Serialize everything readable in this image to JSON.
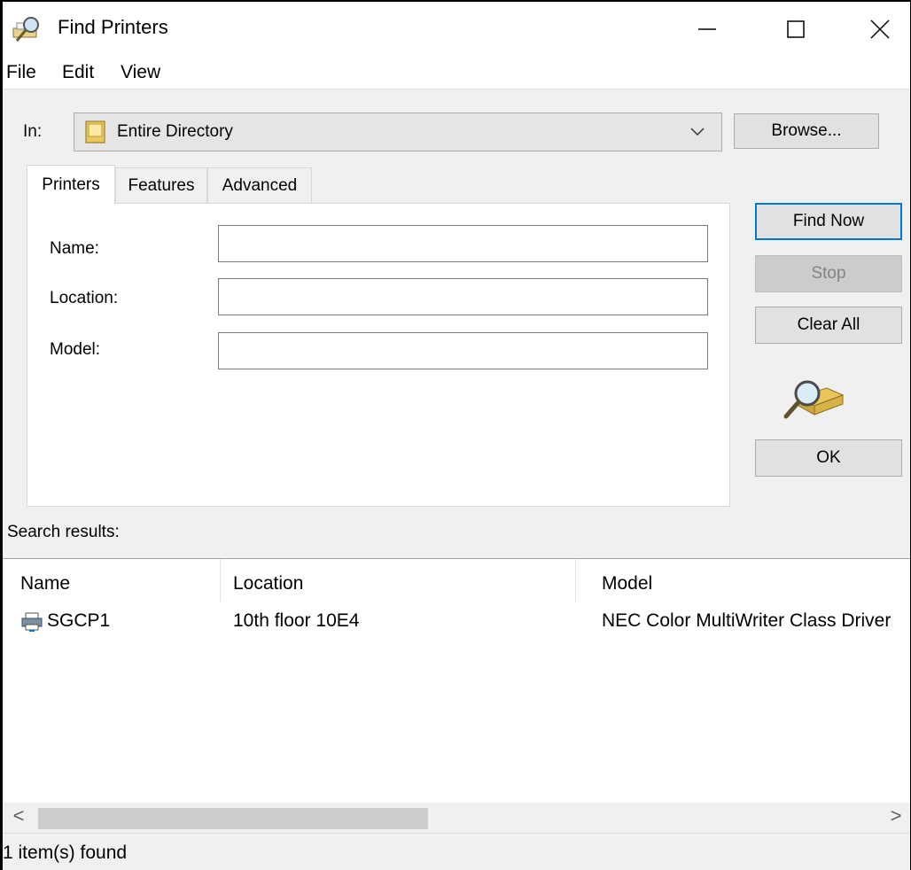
{
  "window": {
    "title": "Find Printers",
    "icon": "find-printer-icon",
    "controls": {
      "minimize": "—",
      "maximize": "☐",
      "close": "✕"
    }
  },
  "menu": [
    "File",
    "Edit",
    "View"
  ],
  "in_row": {
    "label": "In:",
    "selected": "Entire Directory",
    "icon": "directory-book-icon",
    "browse": "Browse..."
  },
  "tabs": [
    "Printers",
    "Features",
    "Advanced"
  ],
  "form": {
    "name_label": "Name:",
    "name_value": "",
    "location_label": "Location:",
    "location_value": "",
    "model_label": "Model:",
    "model_value": ""
  },
  "actions": {
    "find_now": "Find Now",
    "stop": "Stop",
    "clear_all": "Clear All",
    "ok": "OK"
  },
  "results": {
    "label": "Search results:",
    "columns": [
      "Name",
      "Location",
      "Model"
    ],
    "rows": [
      {
        "icon": "printer-icon",
        "name": "SGCP1",
        "location": "10th floor 10E4",
        "model": "NEC Color MultiWriter Class Driver"
      }
    ]
  },
  "scroll": {
    "left": "<",
    "right": ">"
  },
  "status": "1 item(s) found",
  "colors": {
    "accent": "#0078d7",
    "window_bg": "#f0f0f0",
    "disabled_text": "#838383"
  }
}
